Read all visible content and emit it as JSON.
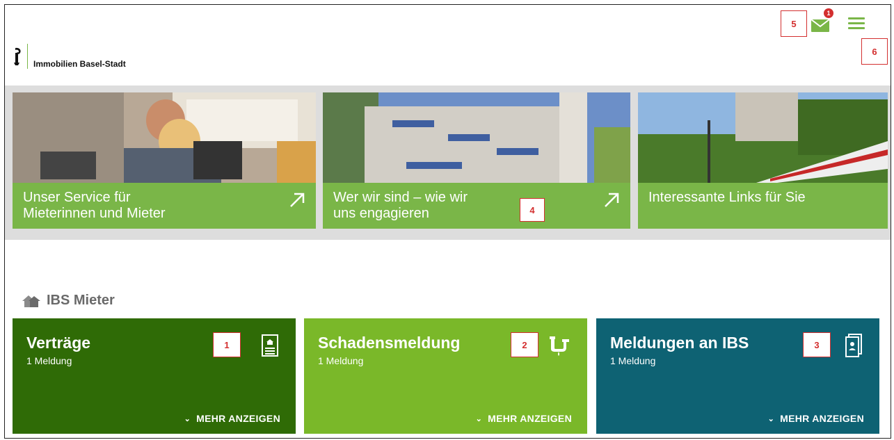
{
  "header": {
    "brand": "Immobilien Basel-Stadt",
    "mail_badge": "1",
    "callouts": {
      "mail": "5",
      "menu": "6"
    }
  },
  "teasers": [
    {
      "title": "Unser Service für\nMieterinnen und Mieter",
      "has_arrow": true
    },
    {
      "title": "Wer wir sind – wie wir\nuns engagieren",
      "has_arrow": true,
      "callout": "4"
    },
    {
      "title": "Interessante Links für Sie",
      "has_arrow": false
    }
  ],
  "section": {
    "title": "IBS Mieter",
    "icon": "house-icon"
  },
  "tiles": [
    {
      "title": "Verträge",
      "subtitle": "1 Meldung",
      "more": "MEHR ANZEIGEN",
      "callout": "1",
      "icon": "contract-document-icon",
      "color": "#2f6b06"
    },
    {
      "title": "Schadensmeldung",
      "subtitle": "1 Meldung",
      "more": "MEHR ANZEIGEN",
      "callout": "2",
      "icon": "pipe-leak-icon",
      "color": "#7ab829"
    },
    {
      "title": "Meldungen an IBS",
      "subtitle": "1 Meldung",
      "more": "MEHR ANZEIGEN",
      "callout": "3",
      "icon": "contact-card-icon",
      "color": "#0e6273"
    }
  ],
  "colors": {
    "accent_green": "#7ab648",
    "callout_red": "#d32f2f"
  }
}
